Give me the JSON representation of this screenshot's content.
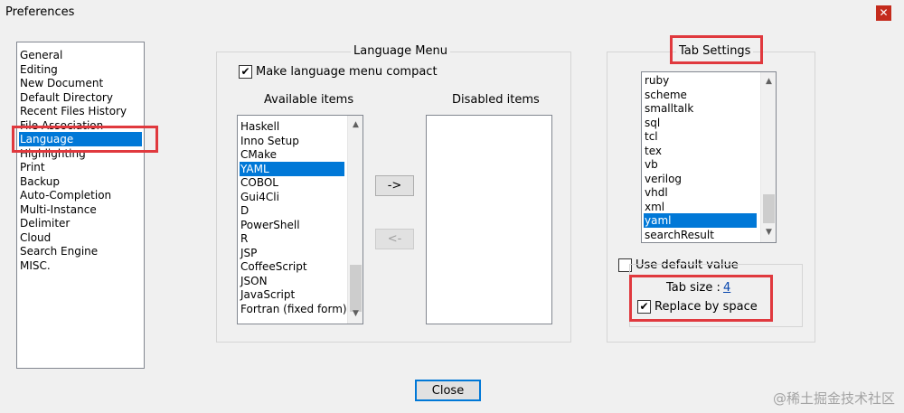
{
  "window": {
    "title": "Preferences",
    "close_glyph": "✕",
    "close_icon": "close-icon"
  },
  "categories": {
    "items": [
      "General",
      "Editing",
      "New Document",
      "Default Directory",
      "Recent Files History",
      "File Association",
      "Language",
      "Highlighting",
      "Print",
      "Backup",
      "Auto-Completion",
      "Multi-Instance",
      "Delimiter",
      "Cloud",
      "Search Engine",
      "MISC."
    ],
    "selected": "Language"
  },
  "language_menu": {
    "title": "Language Menu",
    "compact_label": "Make language menu compact",
    "compact_checked": true,
    "available_header": "Available items",
    "disabled_header": "Disabled items",
    "available_items": [
      "Haskell",
      "Inno Setup",
      "CMake",
      "YAML",
      "COBOL",
      "Gui4Cli",
      "D",
      "PowerShell",
      "R",
      "JSP",
      "CoffeeScript",
      "JSON",
      "JavaScript",
      "Fortran (fixed form)"
    ],
    "available_selected": "YAML",
    "disabled_items": [],
    "move_right_label": "->",
    "move_left_label": "<-"
  },
  "tab_settings": {
    "title": "Tab Settings",
    "languages": [
      "ruby",
      "scheme",
      "smalltalk",
      "sql",
      "tcl",
      "tex",
      "vb",
      "verilog",
      "vhdl",
      "xml",
      "yaml",
      "searchResult"
    ],
    "selected": "yaml",
    "use_default_label": "Use default value",
    "use_default_checked": false,
    "tab_size_label": "Tab size :",
    "tab_size_value": "4",
    "replace_label": "Replace by space",
    "replace_checked": true
  },
  "footer": {
    "close_button": "Close"
  },
  "watermark": "@稀土掘金技术社区",
  "colors": {
    "selection": "#0078d7",
    "highlight_border": "#e0393e",
    "window_bg": "#f0f0f0"
  }
}
